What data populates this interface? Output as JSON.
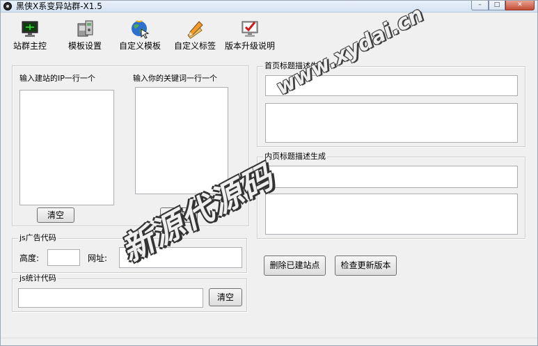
{
  "window": {
    "title": "黑侠X系变异站群-X1.5",
    "min_glyph": "–",
    "max_glyph": "□",
    "close_glyph": "✕"
  },
  "toolbar": [
    {
      "label": "站群主控",
      "icon": "monitor-icon"
    },
    {
      "label": "模板设置",
      "icon": "device-settings-icon"
    },
    {
      "label": "自定义模板",
      "icon": "globe-cursor-icon"
    },
    {
      "label": "自定义标签",
      "icon": "pencil-ruler-icon"
    },
    {
      "label": "版本升级说明",
      "icon": "monitor-check-icon"
    }
  ],
  "left_panel": {
    "ip_label": "输入建站的IP一行一个",
    "ip_value": "",
    "keywords_label": "输入你的关键词一行一个",
    "keywords_value": "",
    "clear_ip_button": "清空",
    "clear_keywords_button": "清空"
  },
  "ad_group": {
    "legend": "js广告代码",
    "height_label": "高度:",
    "height_value": "",
    "url_label": "网址:",
    "url_value": ""
  },
  "stats_group": {
    "legend": "js统计代码",
    "code_value": "",
    "clear_button": "清空"
  },
  "home_group": {
    "legend": "首页标题描述生成",
    "title_value": "",
    "desc_value": ""
  },
  "inner_group": {
    "legend": "内页标题描述生成",
    "title_value": "",
    "desc_value": ""
  },
  "actions": {
    "delete_sites": "删除已建站点",
    "check_update": "检查更新版本"
  },
  "watermark": {
    "url": "www.xydai.cn",
    "cn": "新源代源码"
  }
}
